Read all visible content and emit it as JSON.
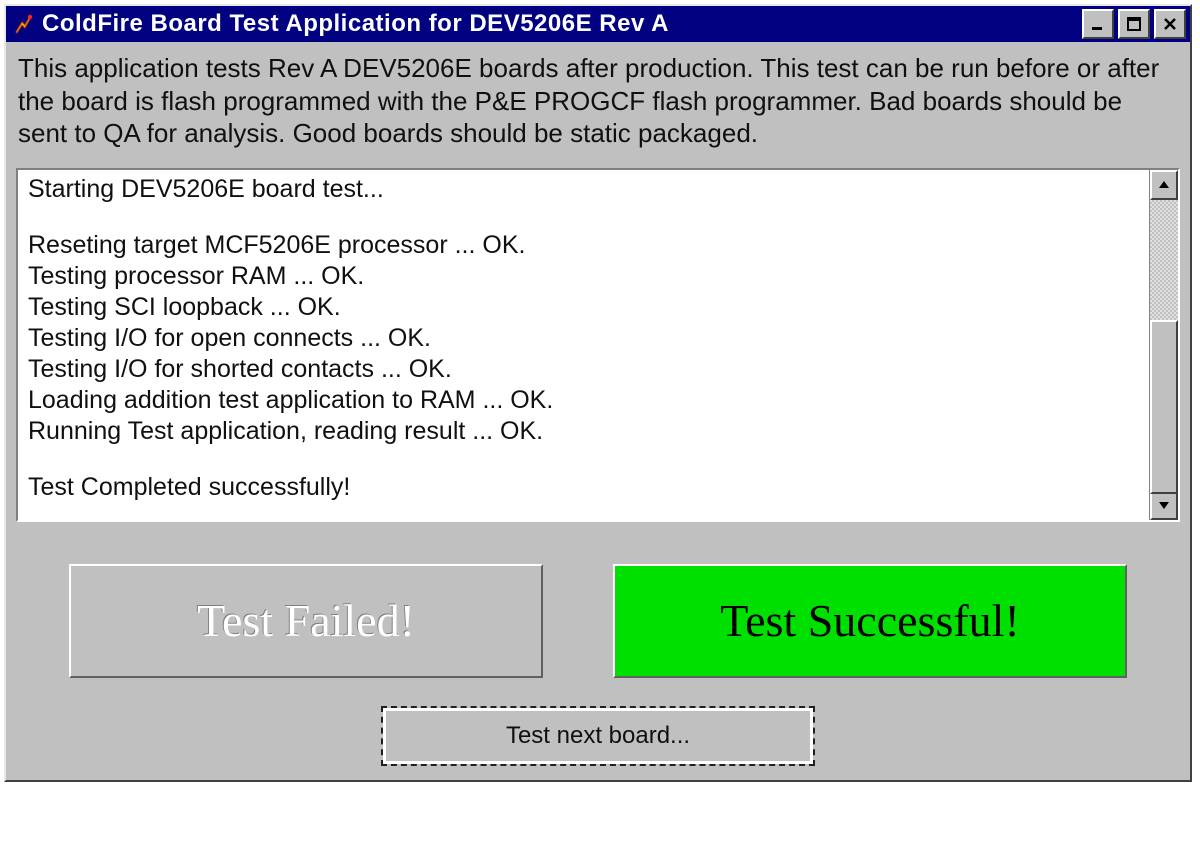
{
  "window": {
    "title": "ColdFire Board Test Application for DEV5206E Rev A"
  },
  "intro": "This application tests Rev A DEV5206E boards after production.  This test can be run before or after the board is flash programmed with the P&E PROGCF flash programmer. Bad boards should be sent to QA for analysis. Good boards should be static packaged.",
  "log": [
    "Starting DEV5206E board test...",
    "",
    "Reseting target MCF5206E processor ... OK.",
    "Testing processor RAM ... OK.",
    "Testing SCI loopback ... OK.",
    "Testing I/O for open connects ... OK.",
    "Testing I/O for shorted contacts ... OK.",
    "Loading addition test application to RAM ... OK.",
    "Running Test application, reading result ... OK.",
    "",
    "Test Completed successfully!"
  ],
  "status": {
    "fail_label": "Test Failed!",
    "pass_label": "Test Successful!"
  },
  "buttons": {
    "next_label": "Test next board..."
  }
}
